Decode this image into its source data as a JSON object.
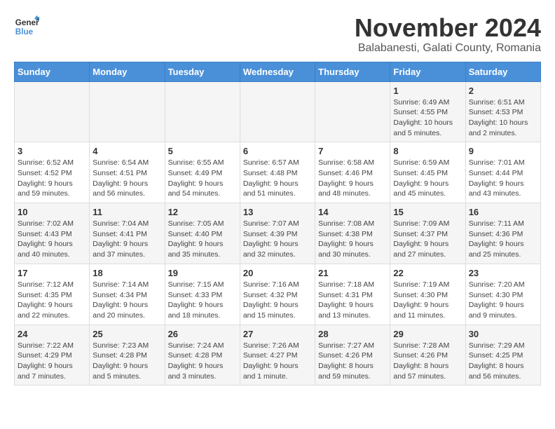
{
  "logo": {
    "line1": "General",
    "line2": "Blue"
  },
  "title": "November 2024",
  "subtitle": "Balabanesti, Galati County, Romania",
  "days_of_week": [
    "Sunday",
    "Monday",
    "Tuesday",
    "Wednesday",
    "Thursday",
    "Friday",
    "Saturday"
  ],
  "weeks": [
    [
      {
        "day": "",
        "info": ""
      },
      {
        "day": "",
        "info": ""
      },
      {
        "day": "",
        "info": ""
      },
      {
        "day": "",
        "info": ""
      },
      {
        "day": "",
        "info": ""
      },
      {
        "day": "1",
        "info": "Sunrise: 6:49 AM\nSunset: 4:55 PM\nDaylight: 10 hours\nand 5 minutes."
      },
      {
        "day": "2",
        "info": "Sunrise: 6:51 AM\nSunset: 4:53 PM\nDaylight: 10 hours\nand 2 minutes."
      }
    ],
    [
      {
        "day": "3",
        "info": "Sunrise: 6:52 AM\nSunset: 4:52 PM\nDaylight: 9 hours\nand 59 minutes."
      },
      {
        "day": "4",
        "info": "Sunrise: 6:54 AM\nSunset: 4:51 PM\nDaylight: 9 hours\nand 56 minutes."
      },
      {
        "day": "5",
        "info": "Sunrise: 6:55 AM\nSunset: 4:49 PM\nDaylight: 9 hours\nand 54 minutes."
      },
      {
        "day": "6",
        "info": "Sunrise: 6:57 AM\nSunset: 4:48 PM\nDaylight: 9 hours\nand 51 minutes."
      },
      {
        "day": "7",
        "info": "Sunrise: 6:58 AM\nSunset: 4:46 PM\nDaylight: 9 hours\nand 48 minutes."
      },
      {
        "day": "8",
        "info": "Sunrise: 6:59 AM\nSunset: 4:45 PM\nDaylight: 9 hours\nand 45 minutes."
      },
      {
        "day": "9",
        "info": "Sunrise: 7:01 AM\nSunset: 4:44 PM\nDaylight: 9 hours\nand 43 minutes."
      }
    ],
    [
      {
        "day": "10",
        "info": "Sunrise: 7:02 AM\nSunset: 4:43 PM\nDaylight: 9 hours\nand 40 minutes."
      },
      {
        "day": "11",
        "info": "Sunrise: 7:04 AM\nSunset: 4:41 PM\nDaylight: 9 hours\nand 37 minutes."
      },
      {
        "day": "12",
        "info": "Sunrise: 7:05 AM\nSunset: 4:40 PM\nDaylight: 9 hours\nand 35 minutes."
      },
      {
        "day": "13",
        "info": "Sunrise: 7:07 AM\nSunset: 4:39 PM\nDaylight: 9 hours\nand 32 minutes."
      },
      {
        "day": "14",
        "info": "Sunrise: 7:08 AM\nSunset: 4:38 PM\nDaylight: 9 hours\nand 30 minutes."
      },
      {
        "day": "15",
        "info": "Sunrise: 7:09 AM\nSunset: 4:37 PM\nDaylight: 9 hours\nand 27 minutes."
      },
      {
        "day": "16",
        "info": "Sunrise: 7:11 AM\nSunset: 4:36 PM\nDaylight: 9 hours\nand 25 minutes."
      }
    ],
    [
      {
        "day": "17",
        "info": "Sunrise: 7:12 AM\nSunset: 4:35 PM\nDaylight: 9 hours\nand 22 minutes."
      },
      {
        "day": "18",
        "info": "Sunrise: 7:14 AM\nSunset: 4:34 PM\nDaylight: 9 hours\nand 20 minutes."
      },
      {
        "day": "19",
        "info": "Sunrise: 7:15 AM\nSunset: 4:33 PM\nDaylight: 9 hours\nand 18 minutes."
      },
      {
        "day": "20",
        "info": "Sunrise: 7:16 AM\nSunset: 4:32 PM\nDaylight: 9 hours\nand 15 minutes."
      },
      {
        "day": "21",
        "info": "Sunrise: 7:18 AM\nSunset: 4:31 PM\nDaylight: 9 hours\nand 13 minutes."
      },
      {
        "day": "22",
        "info": "Sunrise: 7:19 AM\nSunset: 4:30 PM\nDaylight: 9 hours\nand 11 minutes."
      },
      {
        "day": "23",
        "info": "Sunrise: 7:20 AM\nSunset: 4:30 PM\nDaylight: 9 hours\nand 9 minutes."
      }
    ],
    [
      {
        "day": "24",
        "info": "Sunrise: 7:22 AM\nSunset: 4:29 PM\nDaylight: 9 hours\nand 7 minutes."
      },
      {
        "day": "25",
        "info": "Sunrise: 7:23 AM\nSunset: 4:28 PM\nDaylight: 9 hours\nand 5 minutes."
      },
      {
        "day": "26",
        "info": "Sunrise: 7:24 AM\nSunset: 4:28 PM\nDaylight: 9 hours\nand 3 minutes."
      },
      {
        "day": "27",
        "info": "Sunrise: 7:26 AM\nSunset: 4:27 PM\nDaylight: 9 hours\nand 1 minute."
      },
      {
        "day": "28",
        "info": "Sunrise: 7:27 AM\nSunset: 4:26 PM\nDaylight: 8 hours\nand 59 minutes."
      },
      {
        "day": "29",
        "info": "Sunrise: 7:28 AM\nSunset: 4:26 PM\nDaylight: 8 hours\nand 57 minutes."
      },
      {
        "day": "30",
        "info": "Sunrise: 7:29 AM\nSunset: 4:25 PM\nDaylight: 8 hours\nand 56 minutes."
      }
    ]
  ]
}
